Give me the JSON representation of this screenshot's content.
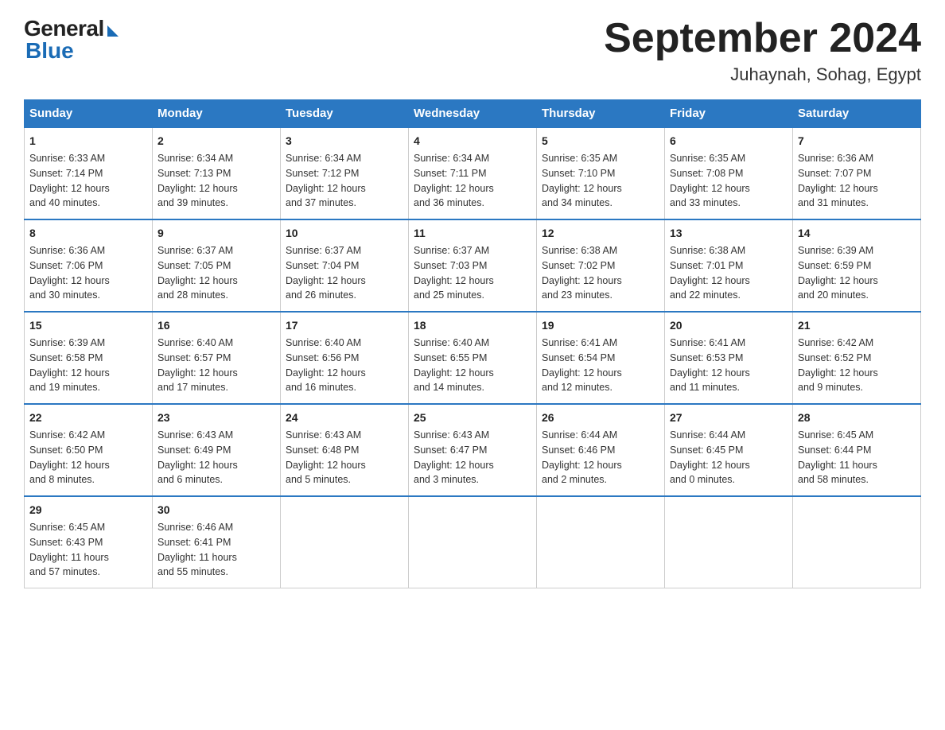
{
  "logo": {
    "general": "General",
    "blue": "Blue"
  },
  "title": "September 2024",
  "location": "Juhaynah, Sohag, Egypt",
  "days_of_week": [
    "Sunday",
    "Monday",
    "Tuesday",
    "Wednesday",
    "Thursday",
    "Friday",
    "Saturday"
  ],
  "weeks": [
    [
      {
        "day": "1",
        "sunrise": "6:33 AM",
        "sunset": "7:14 PM",
        "daylight": "12 hours and 40 minutes."
      },
      {
        "day": "2",
        "sunrise": "6:34 AM",
        "sunset": "7:13 PM",
        "daylight": "12 hours and 39 minutes."
      },
      {
        "day": "3",
        "sunrise": "6:34 AM",
        "sunset": "7:12 PM",
        "daylight": "12 hours and 37 minutes."
      },
      {
        "day": "4",
        "sunrise": "6:34 AM",
        "sunset": "7:11 PM",
        "daylight": "12 hours and 36 minutes."
      },
      {
        "day": "5",
        "sunrise": "6:35 AM",
        "sunset": "7:10 PM",
        "daylight": "12 hours and 34 minutes."
      },
      {
        "day": "6",
        "sunrise": "6:35 AM",
        "sunset": "7:08 PM",
        "daylight": "12 hours and 33 minutes."
      },
      {
        "day": "7",
        "sunrise": "6:36 AM",
        "sunset": "7:07 PM",
        "daylight": "12 hours and 31 minutes."
      }
    ],
    [
      {
        "day": "8",
        "sunrise": "6:36 AM",
        "sunset": "7:06 PM",
        "daylight": "12 hours and 30 minutes."
      },
      {
        "day": "9",
        "sunrise": "6:37 AM",
        "sunset": "7:05 PM",
        "daylight": "12 hours and 28 minutes."
      },
      {
        "day": "10",
        "sunrise": "6:37 AM",
        "sunset": "7:04 PM",
        "daylight": "12 hours and 26 minutes."
      },
      {
        "day": "11",
        "sunrise": "6:37 AM",
        "sunset": "7:03 PM",
        "daylight": "12 hours and 25 minutes."
      },
      {
        "day": "12",
        "sunrise": "6:38 AM",
        "sunset": "7:02 PM",
        "daylight": "12 hours and 23 minutes."
      },
      {
        "day": "13",
        "sunrise": "6:38 AM",
        "sunset": "7:01 PM",
        "daylight": "12 hours and 22 minutes."
      },
      {
        "day": "14",
        "sunrise": "6:39 AM",
        "sunset": "6:59 PM",
        "daylight": "12 hours and 20 minutes."
      }
    ],
    [
      {
        "day": "15",
        "sunrise": "6:39 AM",
        "sunset": "6:58 PM",
        "daylight": "12 hours and 19 minutes."
      },
      {
        "day": "16",
        "sunrise": "6:40 AM",
        "sunset": "6:57 PM",
        "daylight": "12 hours and 17 minutes."
      },
      {
        "day": "17",
        "sunrise": "6:40 AM",
        "sunset": "6:56 PM",
        "daylight": "12 hours and 16 minutes."
      },
      {
        "day": "18",
        "sunrise": "6:40 AM",
        "sunset": "6:55 PM",
        "daylight": "12 hours and 14 minutes."
      },
      {
        "day": "19",
        "sunrise": "6:41 AM",
        "sunset": "6:54 PM",
        "daylight": "12 hours and 12 minutes."
      },
      {
        "day": "20",
        "sunrise": "6:41 AM",
        "sunset": "6:53 PM",
        "daylight": "12 hours and 11 minutes."
      },
      {
        "day": "21",
        "sunrise": "6:42 AM",
        "sunset": "6:52 PM",
        "daylight": "12 hours and 9 minutes."
      }
    ],
    [
      {
        "day": "22",
        "sunrise": "6:42 AM",
        "sunset": "6:50 PM",
        "daylight": "12 hours and 8 minutes."
      },
      {
        "day": "23",
        "sunrise": "6:43 AM",
        "sunset": "6:49 PM",
        "daylight": "12 hours and 6 minutes."
      },
      {
        "day": "24",
        "sunrise": "6:43 AM",
        "sunset": "6:48 PM",
        "daylight": "12 hours and 5 minutes."
      },
      {
        "day": "25",
        "sunrise": "6:43 AM",
        "sunset": "6:47 PM",
        "daylight": "12 hours and 3 minutes."
      },
      {
        "day": "26",
        "sunrise": "6:44 AM",
        "sunset": "6:46 PM",
        "daylight": "12 hours and 2 minutes."
      },
      {
        "day": "27",
        "sunrise": "6:44 AM",
        "sunset": "6:45 PM",
        "daylight": "12 hours and 0 minutes."
      },
      {
        "day": "28",
        "sunrise": "6:45 AM",
        "sunset": "6:44 PM",
        "daylight": "11 hours and 58 minutes."
      }
    ],
    [
      {
        "day": "29",
        "sunrise": "6:45 AM",
        "sunset": "6:43 PM",
        "daylight": "11 hours and 57 minutes."
      },
      {
        "day": "30",
        "sunrise": "6:46 AM",
        "sunset": "6:41 PM",
        "daylight": "11 hours and 55 minutes."
      },
      null,
      null,
      null,
      null,
      null
    ]
  ]
}
